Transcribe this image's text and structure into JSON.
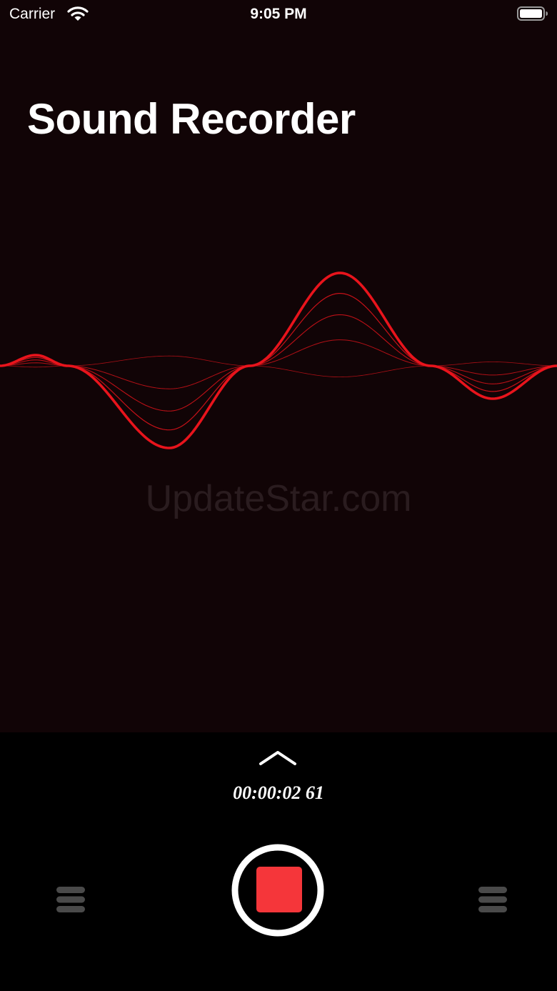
{
  "status_bar": {
    "carrier": "Carrier",
    "time": "9:05 PM",
    "icons": [
      "wifi-icon",
      "battery-icon"
    ]
  },
  "app": {
    "title": "Sound Recorder",
    "watermark": "UpdateStar.com"
  },
  "recorder": {
    "elapsed_time": "00:00:02 61",
    "state": "recording",
    "icons": [
      "chevron-up-icon",
      "stop-icon",
      "list-icon"
    ]
  },
  "colors": {
    "background_upper": "#110406",
    "background_lower": "#000000",
    "wave": "#e8141c",
    "stop_button": "#f5363a",
    "text": "#ffffff",
    "inactive_icon": "#4a4a4a"
  }
}
